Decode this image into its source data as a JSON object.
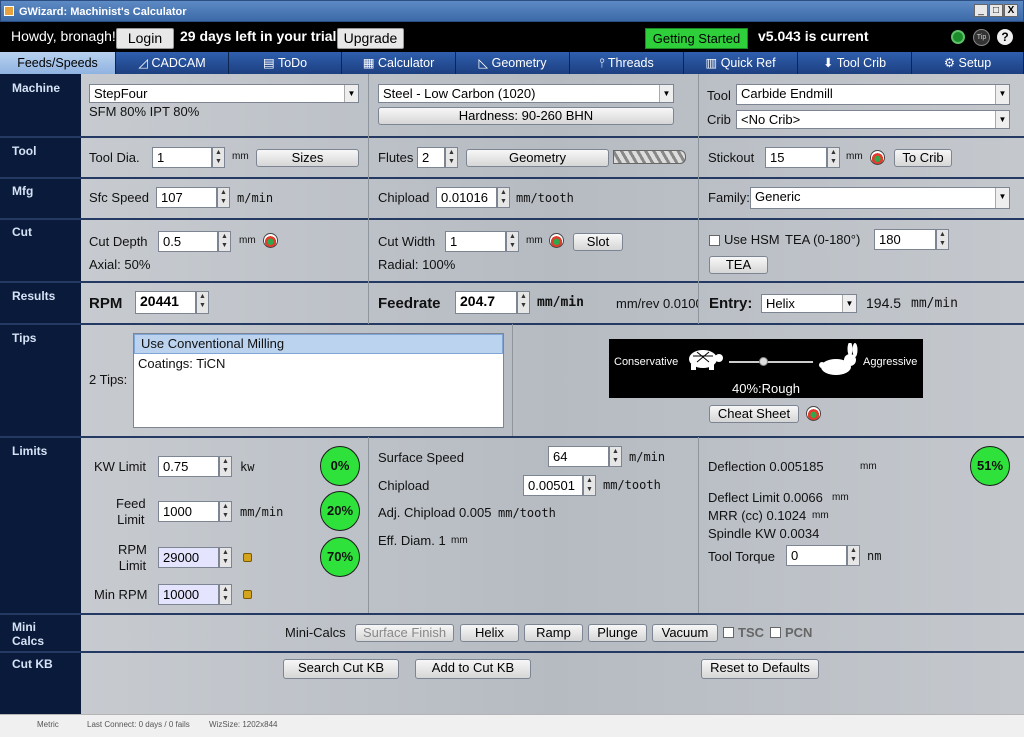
{
  "window": {
    "title": "GWizard: Machinist's Calculator",
    "minimize": "_",
    "maximize": "□",
    "close": "X"
  },
  "header": {
    "greeting": "Howdy, bronagh!",
    "login": "Login",
    "trial": "29 days left in your trial.",
    "upgrade": "Upgrade",
    "getting_started": "Getting Started",
    "version": "v5.043 is current"
  },
  "tabs": [
    {
      "label": "Feeds/Speeds",
      "icon": ""
    },
    {
      "label": "CADCAM",
      "icon": "cadcam-icon"
    },
    {
      "label": "ToDo",
      "icon": "todo-icon"
    },
    {
      "label": "Calculator",
      "icon": "calculator-icon"
    },
    {
      "label": "Geometry",
      "icon": "geometry-icon"
    },
    {
      "label": "Threads",
      "icon": "threads-icon"
    },
    {
      "label": "Quick Ref",
      "icon": "book-icon"
    },
    {
      "label": "Tool Crib",
      "icon": "tool-crib-icon"
    },
    {
      "label": "Setup",
      "icon": "gear-icon"
    }
  ],
  "sections": {
    "machine": "Machine",
    "tool": "Tool",
    "mfg": "Mfg",
    "cut": "Cut",
    "results": "Results",
    "tips": "Tips",
    "limits": "Limits",
    "mini_calcs": "Mini\nCalcs",
    "cut_kb": "Cut KB"
  },
  "machine": {
    "machine_select": "StepFour",
    "sfm_ipt": "SFM 80% IPT 80%",
    "material_select": "Steel - Low Carbon (1020)",
    "hardness": "Hardness: 90-260 BHN",
    "tool_label": "Tool",
    "tool_select": "Carbide Endmill",
    "crib_label": "Crib",
    "crib_select": "<No Crib>"
  },
  "tool": {
    "dia_label": "Tool Dia.",
    "dia_value": "1",
    "dia_unit": "mm",
    "sizes": "Sizes",
    "flutes_label": "Flutes",
    "flutes_value": "2",
    "geometry": "Geometry",
    "stickout_label": "Stickout",
    "stickout_value": "15",
    "stickout_unit": "mm",
    "to_crib": "To Crib"
  },
  "mfg": {
    "sfc_label": "Sfc Speed",
    "sfc_value": "107",
    "sfc_unit": "m/min",
    "chipload_label": "Chipload",
    "chipload_value": "0.01016",
    "chipload_unit": "mm/tooth",
    "family_label": "Family:",
    "family_value": "Generic"
  },
  "cut": {
    "depth_label": "Cut Depth",
    "depth_value": "0.5",
    "depth_unit": "mm",
    "axial": "Axial: 50%",
    "width_label": "Cut Width",
    "width_value": "1",
    "width_unit": "mm",
    "slot": "Slot",
    "radial": "Radial: 100%",
    "use_hsm": "Use HSM",
    "tea_label": "TEA (0-180°)",
    "tea_value": "180",
    "tea_button": "TEA"
  },
  "results": {
    "rpm_label": "RPM",
    "rpm_value": "20441",
    "feed_label": "Feedrate",
    "feed_value": "204.7",
    "feed_unit": "mm/min",
    "mmrev": "mm/rev 0.0100",
    "entry_label": "Entry:",
    "entry_select": "Helix",
    "entry_rate": "194.5",
    "entry_unit": "mm/min"
  },
  "tips": {
    "count": "2 Tips:",
    "items": [
      "Use Conventional Milling",
      "Coatings: TiCN"
    ],
    "conservative": "Conservative",
    "aggressive": "Aggressive",
    "slider_value": 0.4,
    "slider_label": "40%:Rough",
    "cheat_sheet": "Cheat Sheet"
  },
  "limits": {
    "kw_label": "KW Limit",
    "kw_value": "0.75",
    "kw_unit": "kw",
    "kw_pct": "0%",
    "feed_label": "Feed\nLimit",
    "feed_value": "1000",
    "feed_unit": "mm/min",
    "feed_pct": "20%",
    "rpm_label": "RPM\nLimit",
    "rpm_value": "29000",
    "rpm_pct": "70%",
    "minrpm_label": "Min RPM",
    "minrpm_value": "10000",
    "surface_label": "Surface Speed",
    "surface_value": "64",
    "surface_unit": "m/min",
    "chipload_label": "Chipload",
    "chipload_value": "0.00501",
    "chipload_unit": "mm/tooth",
    "adj_chipload": "Adj. Chipload 0.005",
    "adj_unit": "mm/tooth",
    "eff_diam": "Eff. Diam. 1",
    "eff_unit": "mm",
    "deflection": "Deflection 0.005185",
    "deflection_unit": "mm",
    "deflection_pct": "51%",
    "deflect_limit": "Deflect Limit 0.0066",
    "deflect_limit_unit": "mm",
    "mrr": "MRR (cc) 0.1024",
    "mrr_unit": "mm",
    "spindle_kw": "Spindle KW 0.0034",
    "torque_label": "Tool Torque",
    "torque_value": "0",
    "torque_unit": "nm"
  },
  "mini_calcs": {
    "label": "Mini-Calcs",
    "surface_finish": "Surface Finish",
    "helix": "Helix",
    "ramp": "Ramp",
    "plunge": "Plunge",
    "vacuum": "Vacuum",
    "tsc": "TSC",
    "pcn": "PCN"
  },
  "cut_kb": {
    "search": "Search Cut KB",
    "add": "Add to Cut KB",
    "reset": "Reset to Defaults"
  },
  "status": {
    "units": "Metric",
    "last_connect": "Last Connect: 0 days / 0 fails",
    "wizsize": "WizSize: 1202x844"
  }
}
